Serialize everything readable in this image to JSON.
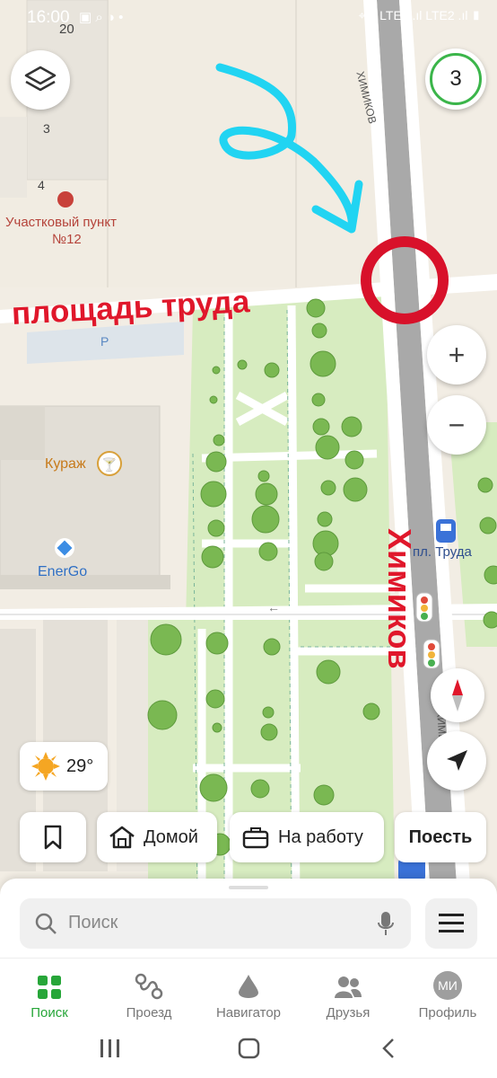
{
  "status_bar": {
    "time": "16:00",
    "icons_left": "▣ ⌕ ◑ •",
    "icons_right": "⌖ ≋ LTE1 .ıl LTE2 .ıl ▮"
  },
  "map": {
    "labels": {
      "building_num_20": "20",
      "building_num_3": "3",
      "building_num_4": "4",
      "police_post": "Участковый пункт",
      "police_post_num": "№12",
      "parking": "P",
      "kurazh": "Кураж",
      "energo": "EnerGo",
      "bus_stop": "пл. Труда",
      "street_top": "ХИМИКОВ",
      "street_bottom": "ХИМИКОВ"
    },
    "annotations": {
      "square_name": "площадь труда",
      "street_name": "Химиков"
    },
    "traffic_badge": "3"
  },
  "weather": {
    "temperature": "29°"
  },
  "quick_chips": {
    "home": "Домой",
    "work": "На работу",
    "eat": "Поесть"
  },
  "search": {
    "placeholder": "Поиск"
  },
  "tabs": [
    {
      "label": "Поиск",
      "active": true
    },
    {
      "label": "Проезд"
    },
    {
      "label": "Навигатор"
    },
    {
      "label": "Друзья"
    },
    {
      "label": "Профиль",
      "avatar_initials": "МИ"
    }
  ],
  "colors": {
    "accent_green": "#27a639",
    "annotation_red": "#e0172b",
    "annotation_cyan": "#21d4f2",
    "park_green": "#d7ecc0"
  }
}
